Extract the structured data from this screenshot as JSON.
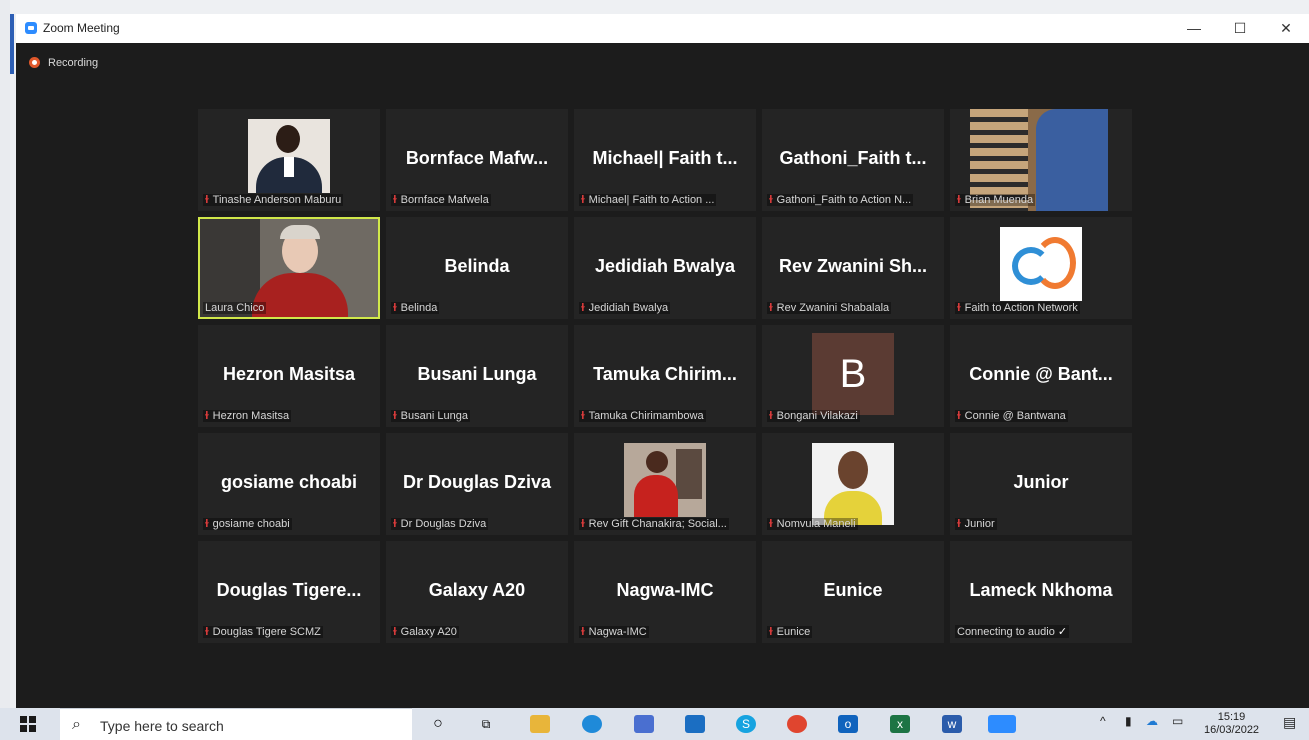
{
  "window": {
    "title": "Zoom Meeting",
    "minimize": "—",
    "maximize": "☐",
    "close": "✕"
  },
  "recording": {
    "label": "Recording"
  },
  "participants": [
    {
      "name": "",
      "label": "Tinashe Anderson Maburu",
      "video": "photo-man-suit"
    },
    {
      "name": "Bornface  Mafw...",
      "label": "Bornface Mafwela"
    },
    {
      "name": "Michael| Faith t...",
      "label": "Michael| Faith to Action ..."
    },
    {
      "name": "Gathoni_Faith  t...",
      "label": "Gathoni_Faith to Action N..."
    },
    {
      "name": "",
      "label": "Brian Muenda",
      "video": "photo-room"
    },
    {
      "name": "",
      "label": "Laura Chico",
      "video": "photo-woman-glasses",
      "active": true,
      "muted": false
    },
    {
      "name": "Belinda",
      "label": "Belinda"
    },
    {
      "name": "Jedidiah Bwalya",
      "label": "Jedidiah Bwalya"
    },
    {
      "name": "Rev Zwanini Sh...",
      "label": "Rev Zwanini Shabalala"
    },
    {
      "name": "",
      "label": "Faith to Action Network",
      "video": "logo"
    },
    {
      "name": "Hezron Masitsa",
      "label": "Hezron Masitsa"
    },
    {
      "name": "Busani Lunga",
      "label": "Busani Lunga"
    },
    {
      "name": "Tamuka  Chirim...",
      "label": "Tamuka Chirimambowa"
    },
    {
      "name": "B",
      "label": "Bongani Vilakazi",
      "video": "letter"
    },
    {
      "name": "Connie @ Bant...",
      "label": "Connie @ Bantwana"
    },
    {
      "name": "gosiame choabi",
      "label": "gosiame choabi"
    },
    {
      "name": "Dr Douglas Dziva",
      "label": "Dr Douglas Dziva"
    },
    {
      "name": "",
      "label": "Rev Gift Chanakira; Social...",
      "video": "photo-red"
    },
    {
      "name": "",
      "label": "Nomvula Maneli",
      "video": "photo-woman-yellow"
    },
    {
      "name": "Junior",
      "label": "Junior"
    },
    {
      "name": "Douglas  Tigere...",
      "label": "Douglas Tigere SCMZ"
    },
    {
      "name": "Galaxy A20",
      "label": "Galaxy A20"
    },
    {
      "name": "Nagwa-IMC",
      "label": "Nagwa-IMC"
    },
    {
      "name": "Eunice",
      "label": "Eunice"
    },
    {
      "name": "Lameck Nkhoma",
      "label": "Connecting to audio",
      "muted": false,
      "connecting": true
    }
  ],
  "taskbar": {
    "search_placeholder": "Type here to search",
    "time": "15:19",
    "date": "16/03/2022"
  },
  "colors": {
    "active_speaker": "#d1e84a",
    "muted_mic": "#e23d3d",
    "tile_bg": "#242424",
    "window_bg": "#1c1c1c"
  }
}
